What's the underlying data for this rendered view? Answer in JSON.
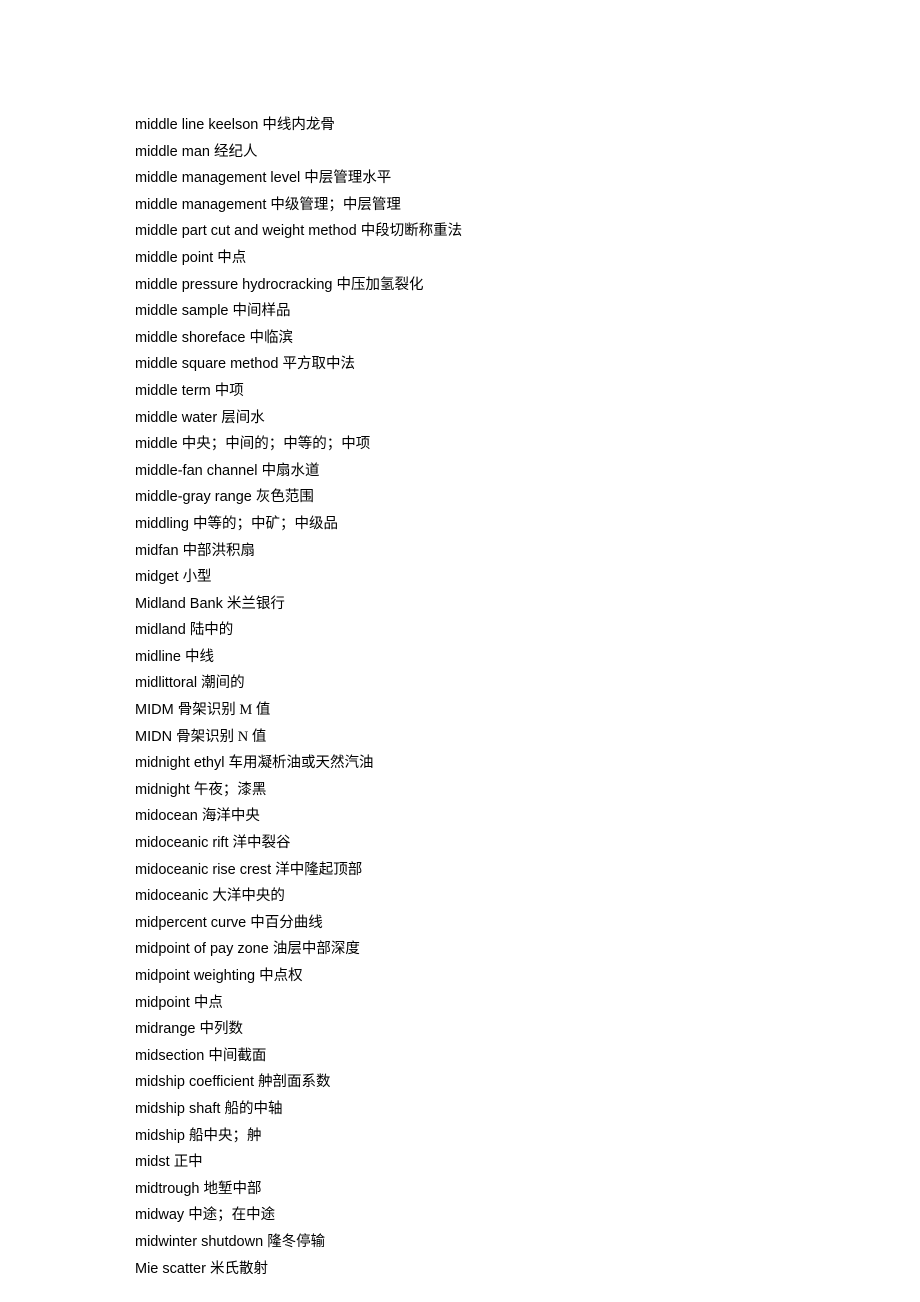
{
  "entries": [
    {
      "term": "middle line keelson",
      "def": "中线内龙骨"
    },
    {
      "term": "middle man",
      "def": "经纪人"
    },
    {
      "term": "middle management level",
      "def": "中层管理水平"
    },
    {
      "term": "middle management",
      "def": "中级管理；中层管理"
    },
    {
      "term": "middle part cut and weight method",
      "def": "中段切断称重法"
    },
    {
      "term": "middle point",
      "def": "中点"
    },
    {
      "term": "middle pressure hydrocracking",
      "def": "中压加氢裂化"
    },
    {
      "term": "middle sample",
      "def": "中间样品"
    },
    {
      "term": "middle shoreface",
      "def": "中临滨"
    },
    {
      "term": "middle square method",
      "def": "平方取中法"
    },
    {
      "term": "middle term",
      "def": "中项"
    },
    {
      "term": "middle water",
      "def": "层间水"
    },
    {
      "term": "middle",
      "def": "中央；中间的；中等的；中项"
    },
    {
      "term": "middle-fan channel",
      "def": "中扇水道"
    },
    {
      "term": "middle-gray range",
      "def": "灰色范围"
    },
    {
      "term": "middling",
      "def": "中等的；中矿；中级品"
    },
    {
      "term": "midfan",
      "def": "中部洪积扇"
    },
    {
      "term": "midget",
      "def": "小型"
    },
    {
      "term": "Midland Bank",
      "def": "米兰银行"
    },
    {
      "term": "midland",
      "def": "陆中的"
    },
    {
      "term": "midline",
      "def": "中线"
    },
    {
      "term": "midlittoral",
      "def": "潮间的"
    },
    {
      "term": "MIDM",
      "def": "骨架识别 M 值"
    },
    {
      "term": "MIDN",
      "def": "骨架识别 N 值"
    },
    {
      "term": "midnight ethyl",
      "def": "车用凝析油或天然汽油"
    },
    {
      "term": "midnight",
      "def": "午夜；漆黑"
    },
    {
      "term": "midocean",
      "def": "海洋中央"
    },
    {
      "term": "midoceanic rift",
      "def": "洋中裂谷"
    },
    {
      "term": "midoceanic rise crest",
      "def": "洋中隆起顶部"
    },
    {
      "term": "midoceanic",
      "def": "大洋中央的"
    },
    {
      "term": "midpercent curve",
      "def": "中百分曲线"
    },
    {
      "term": "midpoint of pay zone",
      "def": "油层中部深度"
    },
    {
      "term": "midpoint weighting",
      "def": "中点权"
    },
    {
      "term": "midpoint",
      "def": "中点"
    },
    {
      "term": "midrange",
      "def": "中列数"
    },
    {
      "term": "midsection",
      "def": "中间截面"
    },
    {
      "term": "midship coefficient",
      "def": "舯剖面系数"
    },
    {
      "term": "midship shaft",
      "def": "船的中轴"
    },
    {
      "term": "midship",
      "def": "船中央；舯"
    },
    {
      "term": "midst",
      "def": "正中"
    },
    {
      "term": "midtrough",
      "def": "地堑中部"
    },
    {
      "term": "midway",
      "def": "中途；在中途"
    },
    {
      "term": "midwinter shutdown",
      "def": "隆冬停输"
    },
    {
      "term": "Mie scatter",
      "def": "米氏散射"
    }
  ]
}
